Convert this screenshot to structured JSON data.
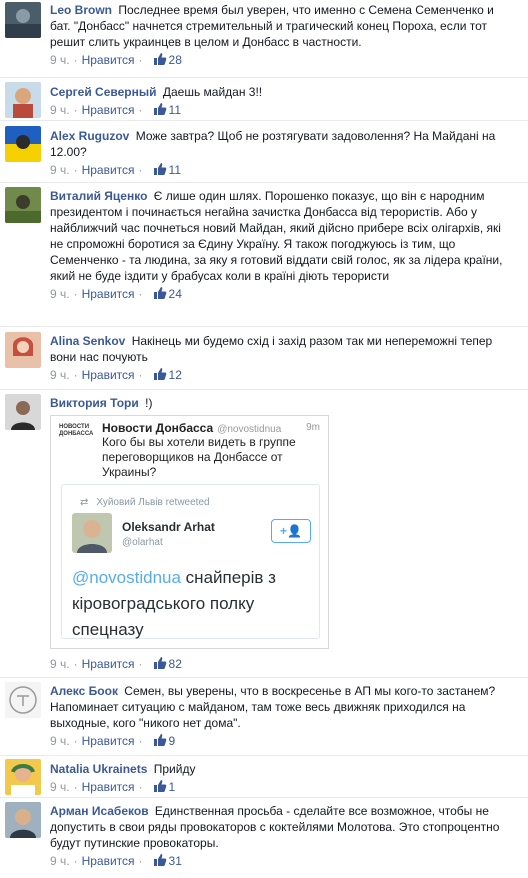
{
  "labels": {
    "like_action": "Нравится",
    "dot": "·"
  },
  "comments": [
    {
      "author": "Leo Brown",
      "text": "Последнее время был уверен, что именно с Семена Семенченко и бат. \"Донбасс\" начнется стремительный и трагический конец Пороха, если тот решит слить украинцев в целом и Донбасс в частности.",
      "time": "9 ч.",
      "likes": "28"
    },
    {
      "author": "Сергей Северный",
      "text": "Даешь майдан 3!!",
      "time": "9 ч.",
      "likes": "11"
    },
    {
      "author": "Alex Ruguzov",
      "text": "Може завтра? Щоб не розтягувати задоволення? На Майдані на 12.00?",
      "time": "9 ч.",
      "likes": "11"
    },
    {
      "author": "Виталий Яценко",
      "text": "Є лише один шлях. Порошенко показує, що він є народним президентом і починається негайна зачистка Донбасса від терористів. Або у найближчий час почнеться новий Майдан, який дійсно прибере всіх олігархів, які не спроможні боротися за Єдину Україну. Я також погоджуюсь із тим, що Семенченко - та людина, за яку я готовий віддати свій голос, як за лідера країни, який не буде іздити у брабусах коли в країні діють терористи",
      "time": "9 ч.",
      "likes": "24"
    },
    {
      "author": "Alina Senkov",
      "text": "Накінець ми будемо схід і захід разом так ми непереможні тепер вони нас почують",
      "time": "9 ч.",
      "likes": "12"
    },
    {
      "author": "Виктория Тори",
      "text": "!)",
      "time": "9 ч.",
      "likes": "82",
      "embed": {
        "logo": "НОВОСТИ ДОНБАССА",
        "name": "Новости Донбасса",
        "handle": "@novostidnua",
        "time": "9m",
        "text": "Кого бы вы хотели видеть в группе переговорщиков на Донбассе от Украины?",
        "retweeted_by": "Хуйовий Львів retweeted",
        "inner_name": "Oleksandr Arhat",
        "inner_handle": "@olarhat",
        "follow": "+👤",
        "inner_mention": "@novostidnua",
        "inner_text": " снайперів з кіровоградського полку спецназу"
      }
    },
    {
      "author": "Алекс Боок",
      "text": "Семен, вы уверены, что в воскресенье в АП мы кого-то застанем? Напоминает ситуацию с майданом, там тоже весь движняк приходился на выходные, кого \"никого нет дома\".",
      "time": "9 ч.",
      "likes": "9"
    },
    {
      "author": "Natalia Ukrainets",
      "text": "Прийду",
      "time": "9 ч.",
      "likes": "1"
    },
    {
      "author": "Арман Исабеков",
      "text": "Единственная просьба - сделайте все возможное, чтобы не допустить в свои ряды провокаторов с коктейлями Молотова. Это стопроцентно будут путинские провокаторы.",
      "time": "9 ч.",
      "likes": "31"
    }
  ]
}
